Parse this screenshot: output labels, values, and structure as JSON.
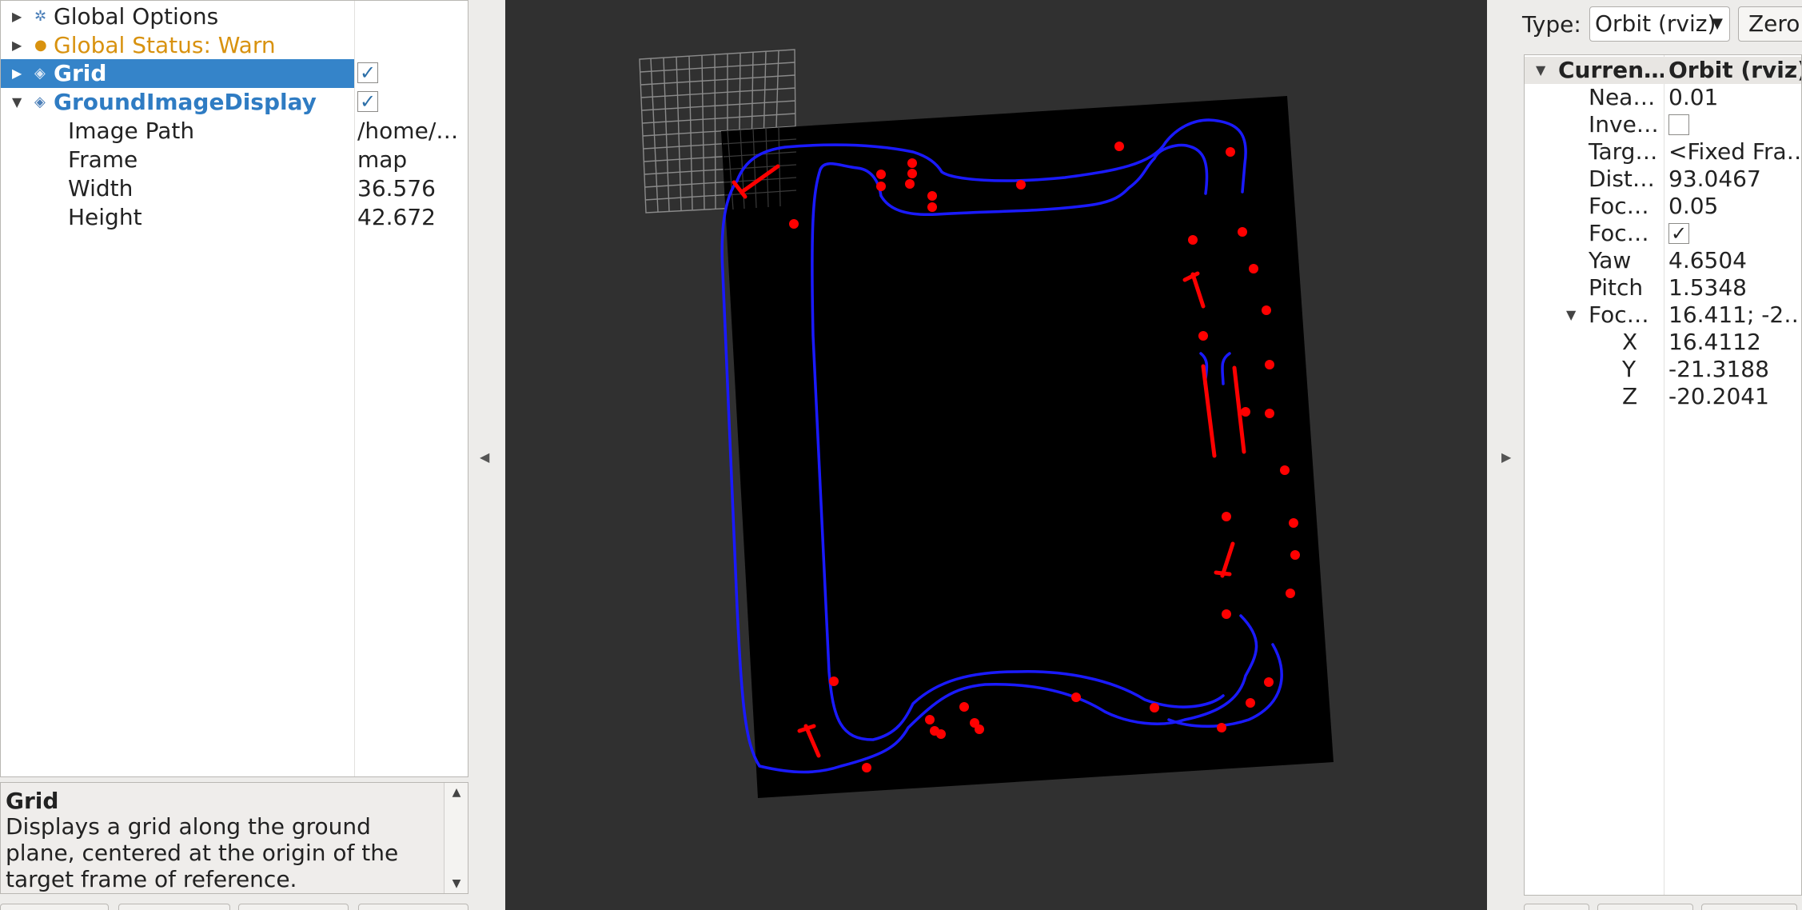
{
  "displays": {
    "rows": [
      {
        "label": "Global Options",
        "value": ""
      },
      {
        "label": "Global Status: Warn",
        "value": ""
      },
      {
        "label": "Grid",
        "value": "✓"
      },
      {
        "label": "GroundImageDisplay",
        "value": "✓"
      },
      {
        "label": "Image Path",
        "value": "/home/…"
      },
      {
        "label": "Frame",
        "value": "map"
      },
      {
        "label": "Width",
        "value": "36.576"
      },
      {
        "label": "Height",
        "value": "42.672"
      }
    ]
  },
  "description": {
    "title": "Grid",
    "text": "Displays a grid along the ground plane, centered at the origin of the target frame of reference."
  },
  "views": {
    "type_label": "Type:",
    "type_value": "Orbit (rviz)",
    "zero_label": "Zero",
    "header": {
      "name": "Curren…",
      "value": "Orbit (rviz)"
    },
    "rows": [
      {
        "name": "Nea…",
        "value": "0.01"
      },
      {
        "name": "Inve…",
        "value": ""
      },
      {
        "name": "Targ…",
        "value": "<Fixed Fra…"
      },
      {
        "name": "Dist…",
        "value": "93.0467"
      },
      {
        "name": "Foc…",
        "value": "0.05"
      },
      {
        "name": "Foc…",
        "value": "✓"
      },
      {
        "name": "Yaw",
        "value": "4.6504"
      },
      {
        "name": "Pitch",
        "value": "1.5348"
      },
      {
        "name": "Foc…",
        "value": "16.411; -2…"
      },
      {
        "name": "X",
        "value": "16.4112"
      },
      {
        "name": "Y",
        "value": "-21.3188"
      },
      {
        "name": "Z",
        "value": "-20.2041"
      }
    ]
  },
  "colors": {
    "viewport_bg": "#303030",
    "map_bg": "#000000",
    "track_line": "#1a1aff",
    "markers": "#ff0000",
    "selection": "#3584c9",
    "warn": "#d8920f"
  }
}
